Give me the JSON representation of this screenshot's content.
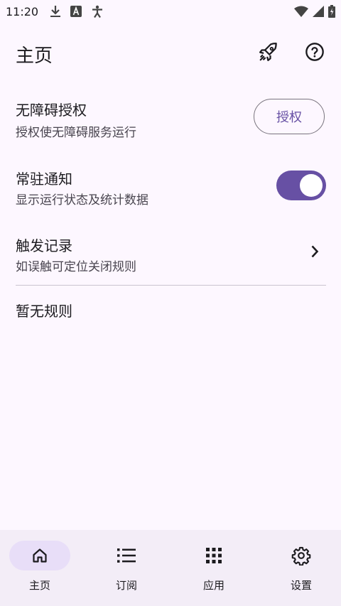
{
  "status_bar": {
    "time": "11:20",
    "left_icons": [
      "download-icon",
      "font-a-icon",
      "accessibility-person-icon"
    ],
    "right_icons": [
      "wifi-icon",
      "cell-signal-icon",
      "battery-charging-icon"
    ]
  },
  "header": {
    "title": "主页",
    "actions": [
      "rocket-icon",
      "help-icon"
    ]
  },
  "settings": {
    "accessibility": {
      "title": "无障碍授权",
      "subtitle": "授权使无障碍服务运行",
      "button_label": "授权"
    },
    "notification": {
      "title": "常驻通知",
      "subtitle": "显示运行状态及统计数据",
      "toggle_on": true
    },
    "trigger_log": {
      "title": "触发记录",
      "subtitle": "如误触可定位关闭规则"
    },
    "empty_rules": "暂无规则"
  },
  "bottom_nav": {
    "items": [
      {
        "label": "主页",
        "icon": "home-icon",
        "selected": true
      },
      {
        "label": "订阅",
        "icon": "list-icon",
        "selected": false
      },
      {
        "label": "应用",
        "icon": "apps-grid-icon",
        "selected": false
      },
      {
        "label": "设置",
        "icon": "gear-icon",
        "selected": false
      }
    ]
  },
  "colors": {
    "background": "#fdf7ff",
    "accent": "#6750a4",
    "nav_background": "#f3edf7",
    "nav_indicator": "#e8def8",
    "text_primary": "#1c1b1f",
    "text_secondary": "#49454f",
    "outline": "#79747e"
  }
}
